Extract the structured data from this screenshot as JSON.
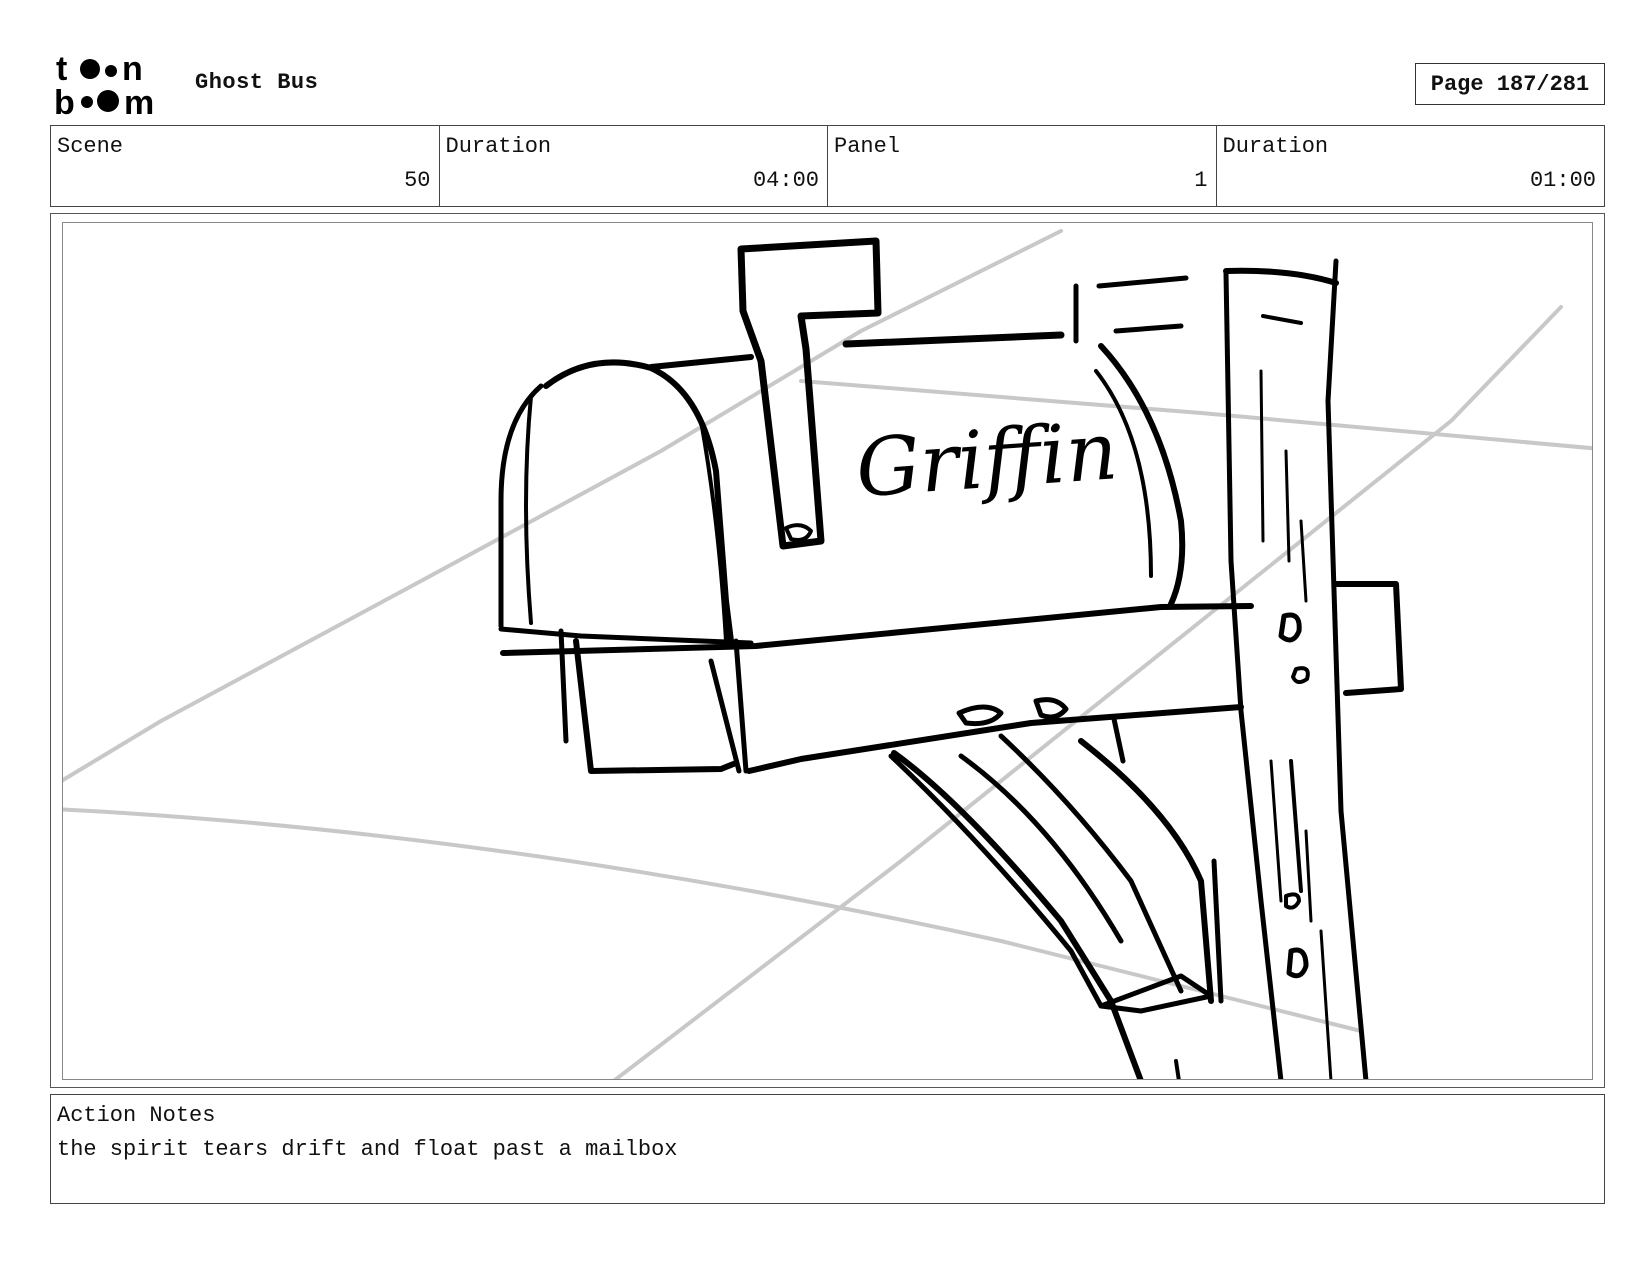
{
  "header": {
    "logo_text": "toon boom",
    "project_title": "Ghost Bus",
    "page_label": "Page 187/281"
  },
  "info": {
    "scene_label": "Scene",
    "scene_value": "50",
    "scene_duration_label": "Duration",
    "scene_duration_value": "04:00",
    "panel_label": "Panel",
    "panel_value": "1",
    "panel_duration_label": "Duration",
    "panel_duration_value": "01:00"
  },
  "panel": {
    "mailbox_name": "Griffin"
  },
  "notes": {
    "label": "Action Notes",
    "text": "the spirit tears drift and float past a mailbox"
  }
}
